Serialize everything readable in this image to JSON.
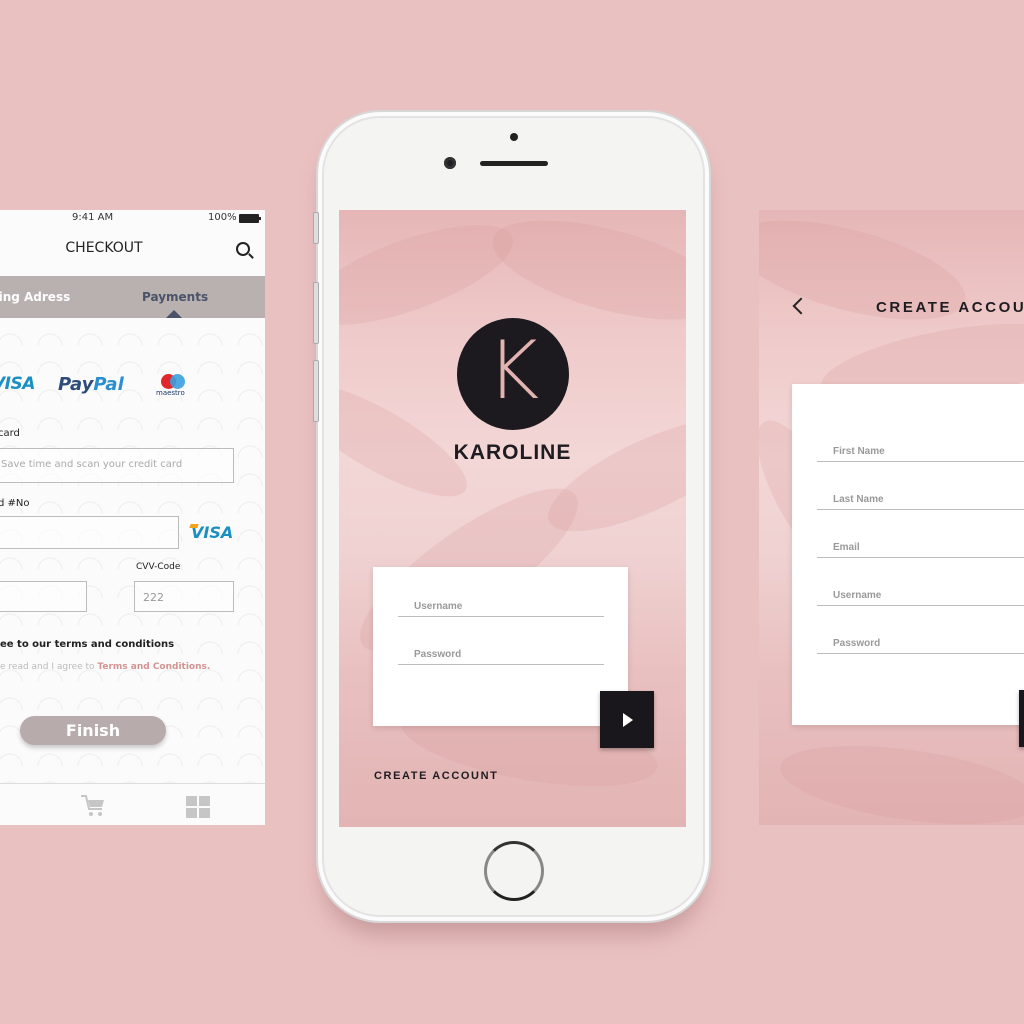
{
  "checkout": {
    "status": {
      "time": "9:41 AM",
      "battery": "100%"
    },
    "title": "CHECKOUT",
    "tabs": [
      {
        "label": "ping Adress",
        "active": false
      },
      {
        "label": "Payments",
        "active": true
      }
    ],
    "payment_methods": [
      {
        "name": "VISA"
      },
      {
        "name_part1": "Pay",
        "name_part2": "Pal"
      },
      {
        "name": "maestro"
      }
    ],
    "scan_label": "card",
    "scan_placeholder": "Save time and scan your credit card",
    "card_no_label": "d #No",
    "card_no_value": "",
    "card_brand": "VISA",
    "expiry_value": "",
    "cvv_label": "CVV-Code",
    "cvv_value": "222",
    "terms_heading": "ee to our terms and conditions",
    "terms_text": "e read and I agree to ",
    "terms_link": "Terms and Conditions.",
    "finish_label": "Finish",
    "bottom_nav": [
      "cart",
      "grid"
    ]
  },
  "login": {
    "logo_letter": "K",
    "brand": "KAROLINE",
    "fields": [
      {
        "placeholder": "Username",
        "value": ""
      },
      {
        "placeholder": "Password",
        "value": ""
      }
    ],
    "submit_icon": "play-arrow",
    "create_account_link": "CREATE ACCOUNT"
  },
  "signup": {
    "title": "CREATE ACCOU",
    "fields": [
      {
        "placeholder": "First Name",
        "value": ""
      },
      {
        "placeholder": "Last Name",
        "value": ""
      },
      {
        "placeholder": "Email",
        "value": ""
      },
      {
        "placeholder": "Username",
        "value": ""
      },
      {
        "placeholder": "Password",
        "value": ""
      }
    ]
  },
  "colors": {
    "background": "#eac1c1",
    "brand_dark": "#1d1a1f",
    "accent_pink": "#e2b4b1",
    "tab_bar": "#b9b0b0",
    "finish_button": "#b7abab",
    "link_pink": "#d49393"
  }
}
